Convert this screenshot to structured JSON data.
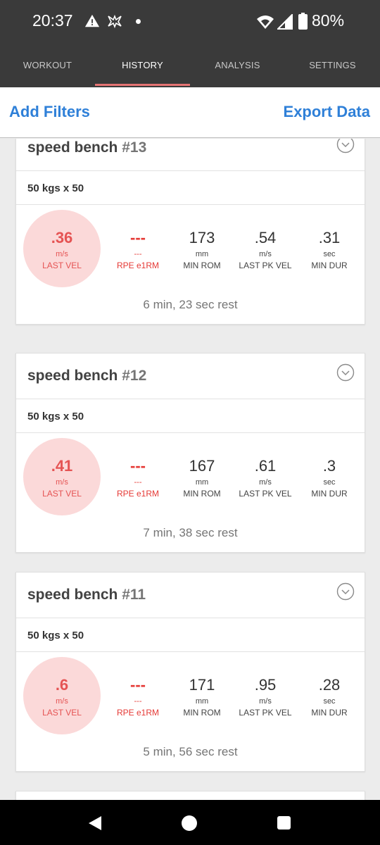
{
  "status_bar": {
    "time": "20:37",
    "battery": "80%",
    "icons": [
      "warning-icon",
      "app-notification-icon",
      "dot-icon",
      "wifi-icon",
      "signal-icon",
      "battery-icon"
    ]
  },
  "tabs": [
    {
      "label": "WORKOUT",
      "active": false
    },
    {
      "label": "HISTORY",
      "active": true
    },
    {
      "label": "ANALYSIS",
      "active": false
    },
    {
      "label": "SETTINGS",
      "active": false
    }
  ],
  "actions": {
    "add_filters": "Add Filters",
    "export_data": "Export Data"
  },
  "colors": {
    "accent": "#2f80d8",
    "tab_indicator": "#e57373",
    "velocity": "#e55353",
    "velocity_bg": "#fbd9d9",
    "rpe": "#e53935"
  },
  "sets": [
    {
      "exercise": "speed bench",
      "number": "#13",
      "load": "50 kgs x 50",
      "last_vel": {
        "value": ".36",
        "unit": "m/s",
        "label": "LAST VEL"
      },
      "rpe": {
        "value": "---",
        "unit": "---",
        "label": "RPE e1RM"
      },
      "min_rom": {
        "value": "173",
        "unit": "mm",
        "label": "MIN ROM"
      },
      "last_pk_vel": {
        "value": ".54",
        "unit": "m/s",
        "label": "LAST PK VEL"
      },
      "min_dur": {
        "value": ".31",
        "unit": "sec",
        "label": "MIN DUR"
      },
      "rest": "6 min, 23 sec rest"
    },
    {
      "exercise": "speed bench",
      "number": "#12",
      "load": "50 kgs x 50",
      "last_vel": {
        "value": ".41",
        "unit": "m/s",
        "label": "LAST VEL"
      },
      "rpe": {
        "value": "---",
        "unit": "---",
        "label": "RPE e1RM"
      },
      "min_rom": {
        "value": "167",
        "unit": "mm",
        "label": "MIN ROM"
      },
      "last_pk_vel": {
        "value": ".61",
        "unit": "m/s",
        "label": "LAST PK VEL"
      },
      "min_dur": {
        "value": ".3",
        "unit": "sec",
        "label": "MIN DUR"
      },
      "rest": "7 min, 38 sec rest"
    },
    {
      "exercise": "speed bench",
      "number": "#11",
      "load": "50 kgs x 50",
      "last_vel": {
        "value": ".6",
        "unit": "m/s",
        "label": "LAST VEL"
      },
      "rpe": {
        "value": "---",
        "unit": "---",
        "label": "RPE e1RM"
      },
      "min_rom": {
        "value": "171",
        "unit": "mm",
        "label": "MIN ROM"
      },
      "last_pk_vel": {
        "value": ".95",
        "unit": "m/s",
        "label": "LAST PK VEL"
      },
      "min_dur": {
        "value": ".28",
        "unit": "sec",
        "label": "MIN DUR"
      },
      "rest": "5 min, 56 sec rest"
    }
  ]
}
